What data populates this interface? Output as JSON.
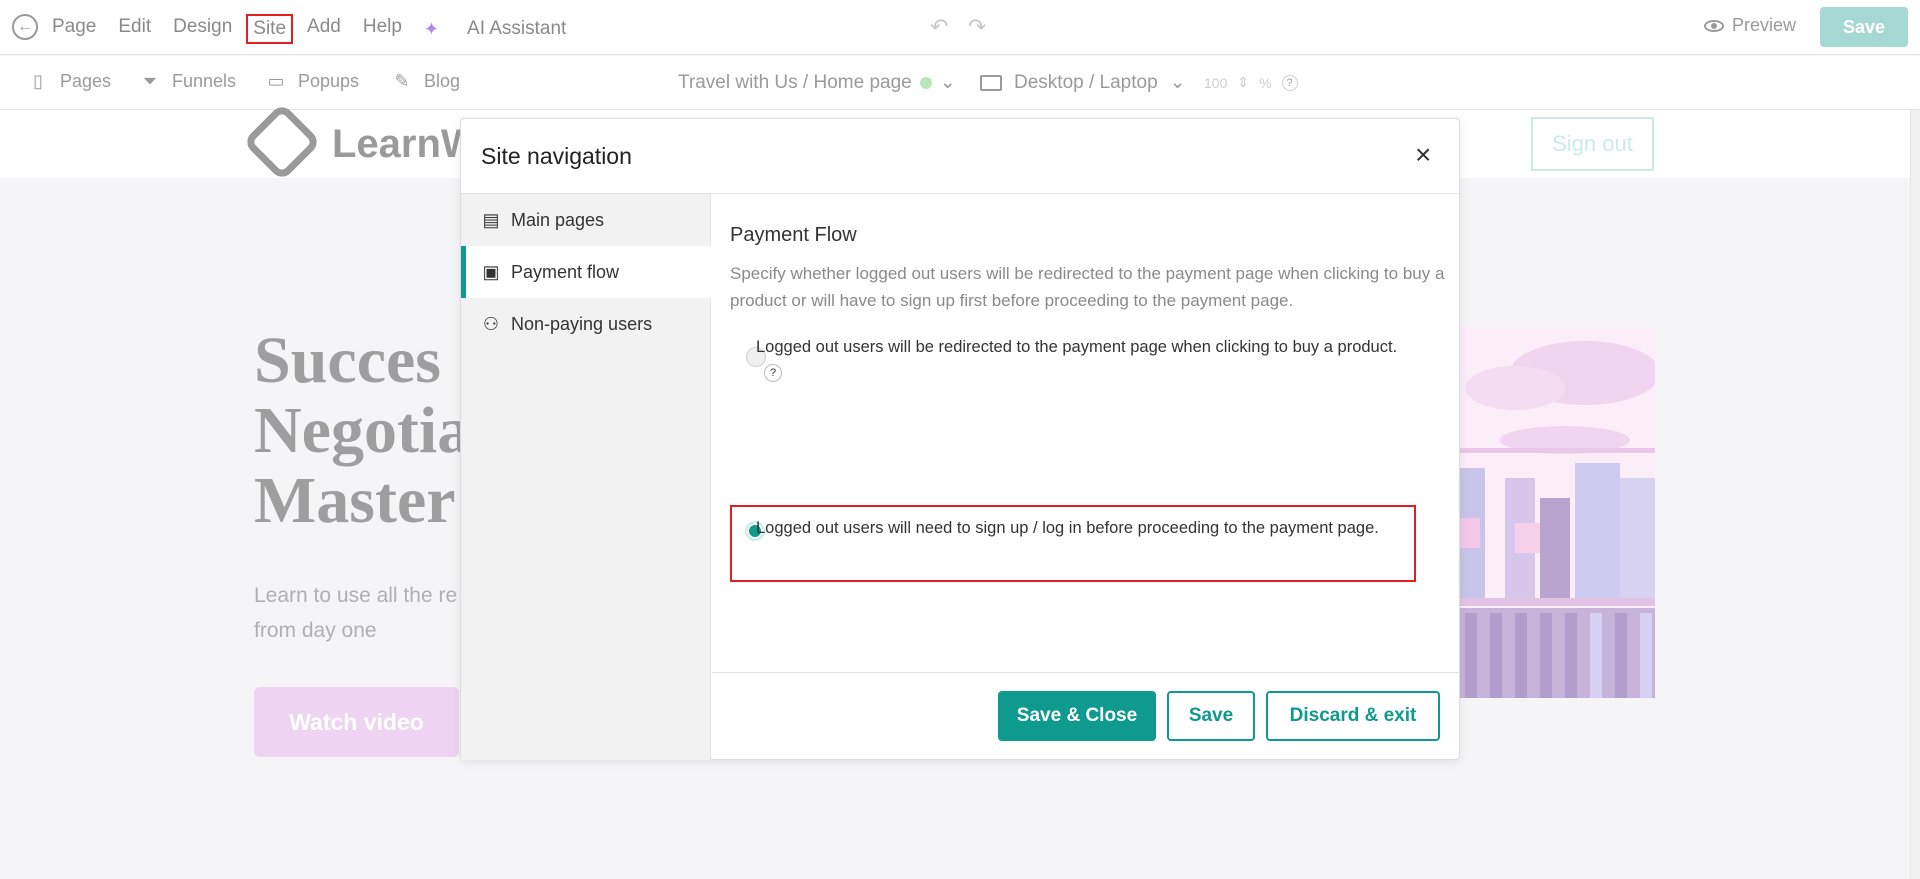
{
  "topbar": {
    "menu": [
      "Page",
      "Edit",
      "Design",
      "Site",
      "Add",
      "Help"
    ],
    "ai_label": "AI Assistant",
    "preview_label": "Preview",
    "save_label": "Save"
  },
  "toolbar2": {
    "pages": "Pages",
    "funnels": "Funnels",
    "popups": "Popups",
    "blog": "Blog",
    "page_selector": "Travel with Us / Home page",
    "device": "Desktop / Laptop",
    "zoom_value": "100",
    "zoom_unit": "%",
    "help": "?"
  },
  "background_page": {
    "logo_text": "LearnW",
    "sign_out": "Sign out",
    "hero_lines": [
      "Succes",
      "Negotia",
      "Master"
    ],
    "sub_lines": [
      "Learn to use all the re",
      "from day one"
    ],
    "watch_video": "Watch video"
  },
  "modal": {
    "title": "Site navigation",
    "close": "×",
    "sidebar": {
      "items": [
        {
          "label": "Main pages",
          "icon": "page-icon"
        },
        {
          "label": "Payment flow",
          "icon": "wallet-icon"
        },
        {
          "label": "Non-paying users",
          "icon": "users-icon"
        }
      ]
    },
    "content": {
      "title": "Payment Flow",
      "description": "Specify whether logged out users will be redirected to the payment page when clicking to buy a product or will have to sign up first before proceeding to the payment page.",
      "option1": "Logged out users will be redirected to the payment page when clicking to buy a product.",
      "option1_help": "?",
      "option2": "Logged out users will need to sign up / log in before proceeding to the payment page.",
      "selected": 2
    },
    "footer": {
      "save_close": "Save & Close",
      "save": "Save",
      "discard": "Discard  & exit"
    }
  },
  "colors": {
    "accent": "#0f9a8f",
    "highlight": "#e02020"
  }
}
